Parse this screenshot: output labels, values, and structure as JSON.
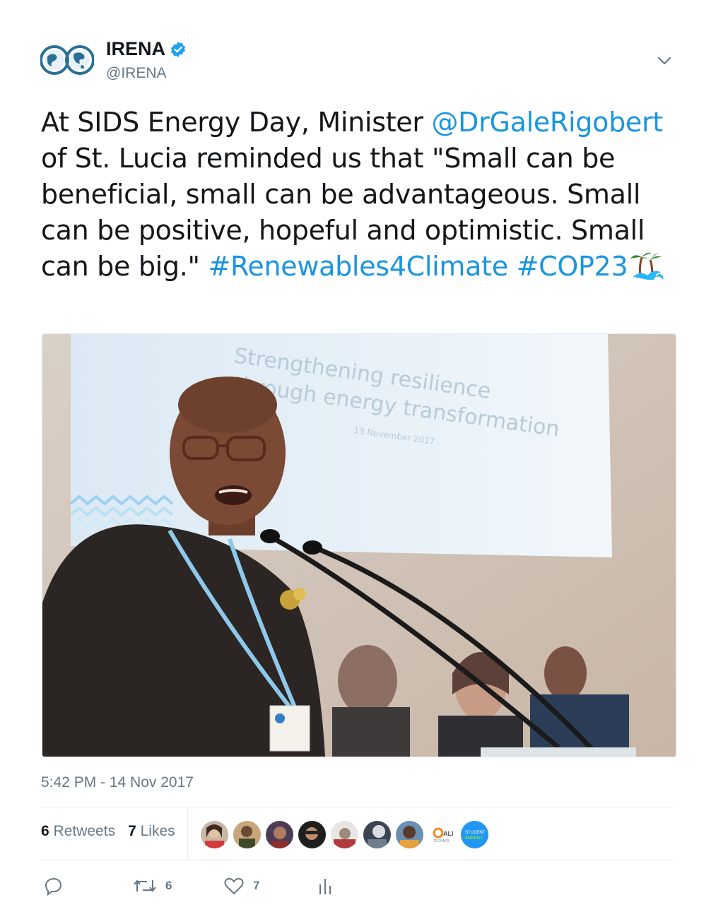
{
  "account": {
    "name": "IRENA",
    "handle": "@IRENA",
    "verified": true,
    "avatar_icon": "irena-globe-logo-icon"
  },
  "tweet": {
    "text_part1": "At SIDS Energy Day, Minister",
    "mention": "@DrGaleRigobert",
    "text_part2": " of St. Lucia reminded us that \"Small can be beneficial, small can be advantageous. Small can be positive, hopeful and optimistic. Small can be big.\"",
    "hashtag1": "#Renewables4Climate",
    "hashtag2": "#COP23",
    "emoji": "island-wave-emoji",
    "photo_description": "",
    "link_color": "#1b95e0"
  },
  "photo": {
    "screen_text_line1": "Strengthening resilience",
    "screen_text_line2": "through energy transformation",
    "screen_text_line3": "13 November 2017"
  },
  "timestamp": "5:42 PM - 14 Nov 2017",
  "stats": {
    "retweets_count": "6",
    "retweets_label": "Retweets",
    "likes_count": "7",
    "likes_label": "Likes"
  },
  "likers": [
    "liker-1",
    "liker-2",
    "liker-3",
    "liker-4",
    "liker-5",
    "liker-6",
    "liker-7",
    "liker-ali-technol",
    "liker-student-energy"
  ],
  "liker_labels": {
    "ali": "ALI TECHNOL",
    "student_energy": "STUDENT ENERGY"
  },
  "actions": {
    "reply_count": "",
    "retweet_count": "6",
    "like_count": "7"
  },
  "colors": {
    "brand": "#1da1f2",
    "link": "#1b95e0",
    "muted": "#657786",
    "text": "#14171a"
  }
}
